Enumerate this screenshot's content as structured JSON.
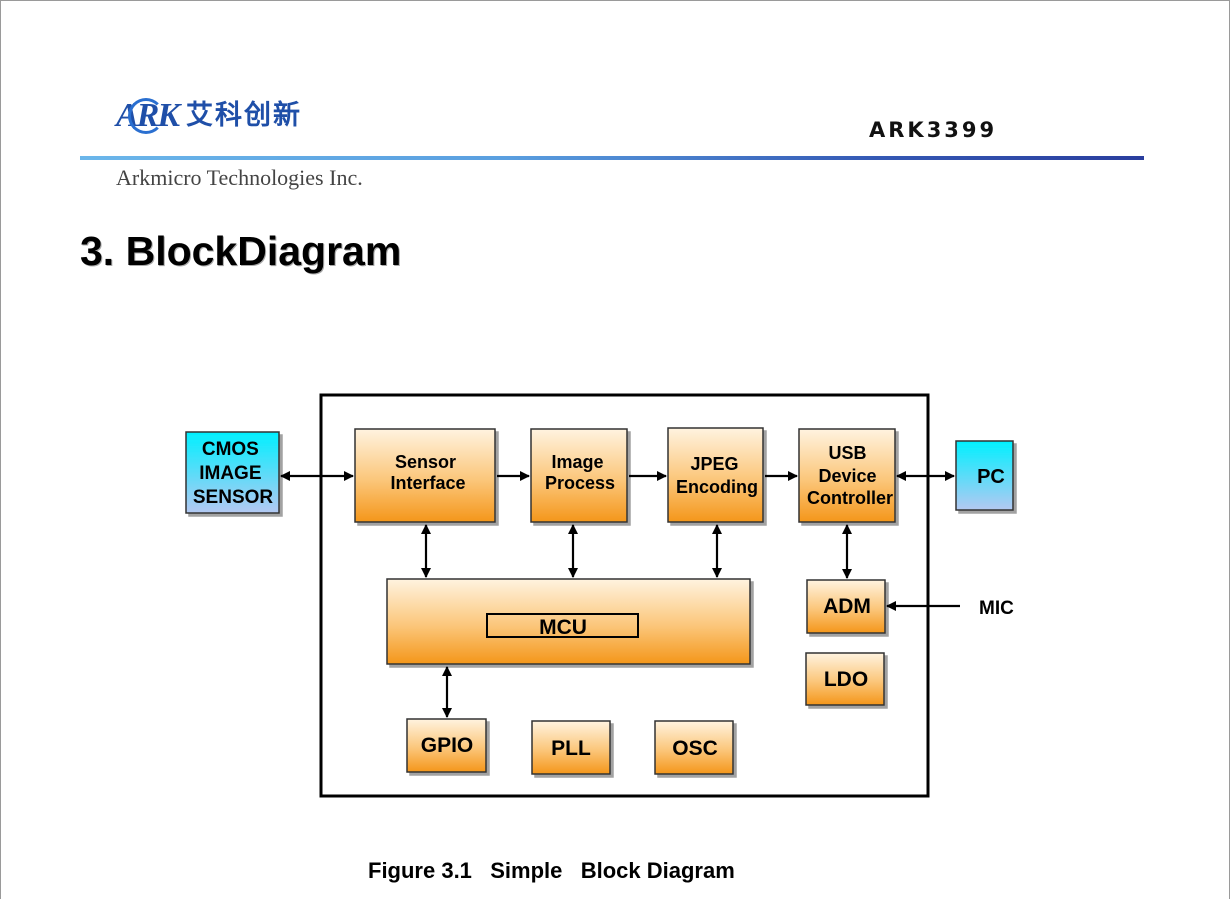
{
  "header": {
    "logo_text": "ARK",
    "logo_cn": "艾科创新",
    "company": "Arkmicro  Technologies Inc.",
    "chip": "ARK3399"
  },
  "section_title": "3. BlockDiagram",
  "caption": "Figure 3.1   Simple   Block Diagram",
  "colors": {
    "orange_top": "#fff2de",
    "orange_bottom": "#f59a1a",
    "cyan_top": "#00f0ff",
    "cyan_bottom": "#b0c8f0",
    "rule_left": "#6bb6ea",
    "rule_right": "#2a3e9e"
  },
  "diagram": {
    "external": {
      "cmos": [
        "CMOS",
        "IMAGE",
        "SENSOR"
      ],
      "pc": "PC",
      "mic": "MIC"
    },
    "blocks": {
      "sensor_interface": [
        "Sensor",
        "Interface"
      ],
      "image_process": [
        "Image",
        "Process"
      ],
      "jpeg_encoding": [
        "JPEG",
        "Encoding"
      ],
      "usb_controller": [
        "USB",
        "Device",
        "Controller"
      ],
      "mcu": "MCU",
      "adm": "ADM",
      "ldo": "LDO",
      "gpio": "GPIO",
      "pll": "PLL",
      "osc": "OSC"
    }
  }
}
